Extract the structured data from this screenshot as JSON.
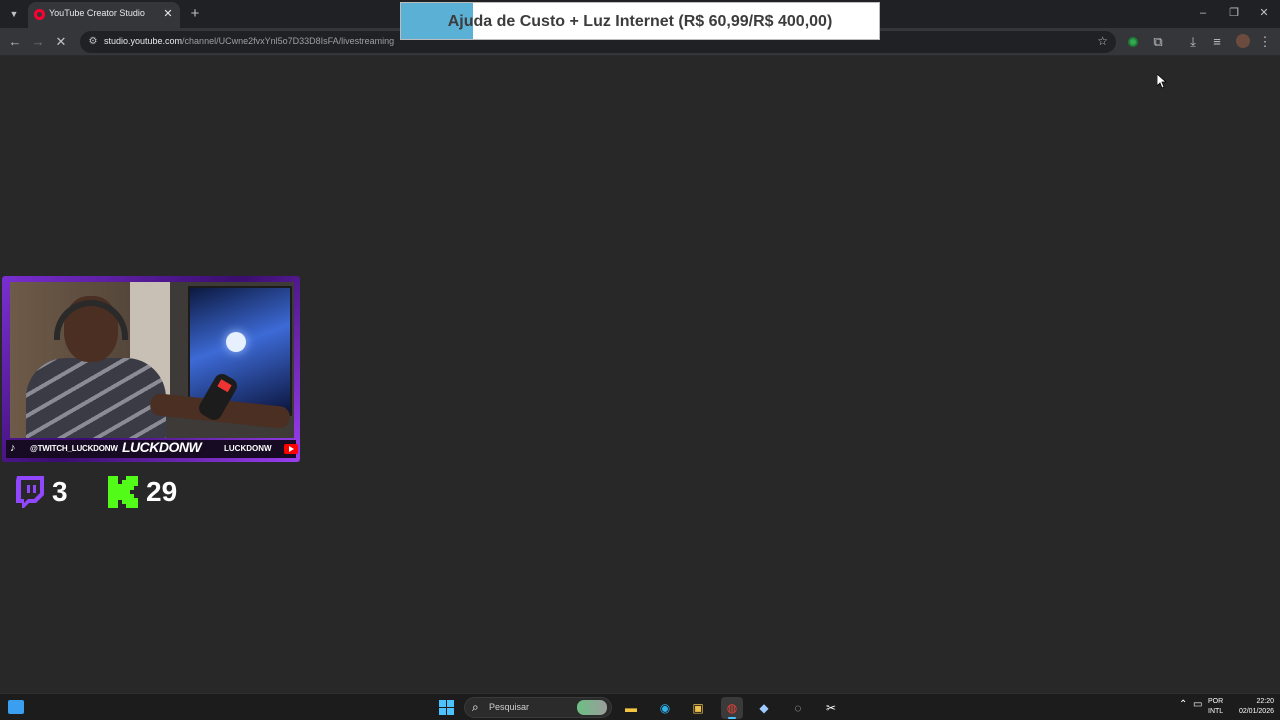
{
  "browser": {
    "tab": {
      "title": "YouTube Creator Studio",
      "favicon": "youtube-studio-icon"
    },
    "url_host": "studio.youtube.com",
    "url_path": "/channel/UCwne2fvxYnl5o7D33D8IsFA/livestreaming",
    "accent": "#202124"
  },
  "overlay": {
    "goal_banner": {
      "text": "Ajuda de Custo + Luz Internet (R$ 60,99/R$ 400,00)",
      "progress": 0.15
    },
    "webcam": {
      "tiktok_handle": "@TWITCH_LUCKDONW",
      "channel_name": "LUCKDONW",
      "youtube_name": "LUCKDONW"
    },
    "viewers": {
      "twitch": "3",
      "kick": "29",
      "twitch_color": "#9146ff",
      "kick_color": "#53fc18"
    }
  },
  "taskbar": {
    "search_placeholder": "Pesquisar",
    "lang_line1": "POR",
    "lang_line2": "INTL",
    "time": "22:20",
    "date": "02/01/2026"
  }
}
